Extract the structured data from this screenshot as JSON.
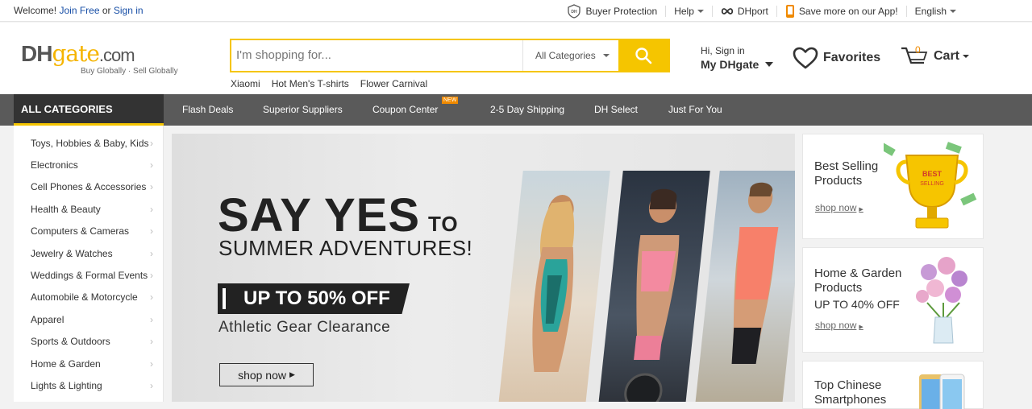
{
  "topbar": {
    "welcome": "Welcome!",
    "join_free": "Join Free",
    "or": "or",
    "sign_in": "Sign in",
    "buyer_protection": "Buyer Protection",
    "help": "Help",
    "dhport": "DHport",
    "app": "Save more on our App!",
    "language": "English"
  },
  "header": {
    "logo_dh": "DH",
    "logo_gate": "gate",
    "logo_com": ".com",
    "logo_tagline": "Buy Globally · Sell Globally",
    "search_placeholder": "I'm shopping for...",
    "search_category": "All Categories",
    "hotwords": [
      "Xiaomi",
      "Hot Men's T-shirts",
      "Flower Carnival"
    ],
    "hi_sign_in": "Hi, Sign in",
    "my_dhgate": "My DHgate",
    "favorites": "Favorites",
    "cart": "Cart",
    "cart_count": "0"
  },
  "nav": {
    "all_categories": "ALL CATEGORIES",
    "links": [
      "Flash Deals",
      "Superior Suppliers",
      "Coupon Center",
      "2-5 Day Shipping",
      "DH Select",
      "Just For You"
    ],
    "new_badge": "NEW"
  },
  "sidebar": {
    "items": [
      "Toys, Hobbies & Baby, Kids",
      "Electronics",
      "Cell Phones & Accessories",
      "Health & Beauty",
      "Computers & Cameras",
      "Jewelry & Watches",
      "Weddings & Formal Events",
      "Automobile & Motorcycle",
      "Apparel",
      "Sports & Outdoors",
      "Home & Garden",
      "Lights & Lighting"
    ]
  },
  "banner": {
    "say_yes": "SAY YES",
    "to": "TO",
    "summer": "SUMMER ADVENTURES!",
    "offer": "UP TO 50% OFF",
    "athletic": "Athletic Gear Clearance",
    "shop_now": "shop now"
  },
  "cards": [
    {
      "title": "Best Selling Products",
      "sub": "",
      "shop": "shop now",
      "trophy_text": "BEST SELLING"
    },
    {
      "title": "Home & Garden Products",
      "sub": "UP TO 40% OFF",
      "shop": "shop now"
    },
    {
      "title": "Top Chinese Smartphones",
      "sub": "",
      "shop": ""
    }
  ],
  "colors": {
    "accent": "#f5c500",
    "nav_bg": "#5a5a5a",
    "link": "#174ea6",
    "orange": "#f08a00"
  }
}
